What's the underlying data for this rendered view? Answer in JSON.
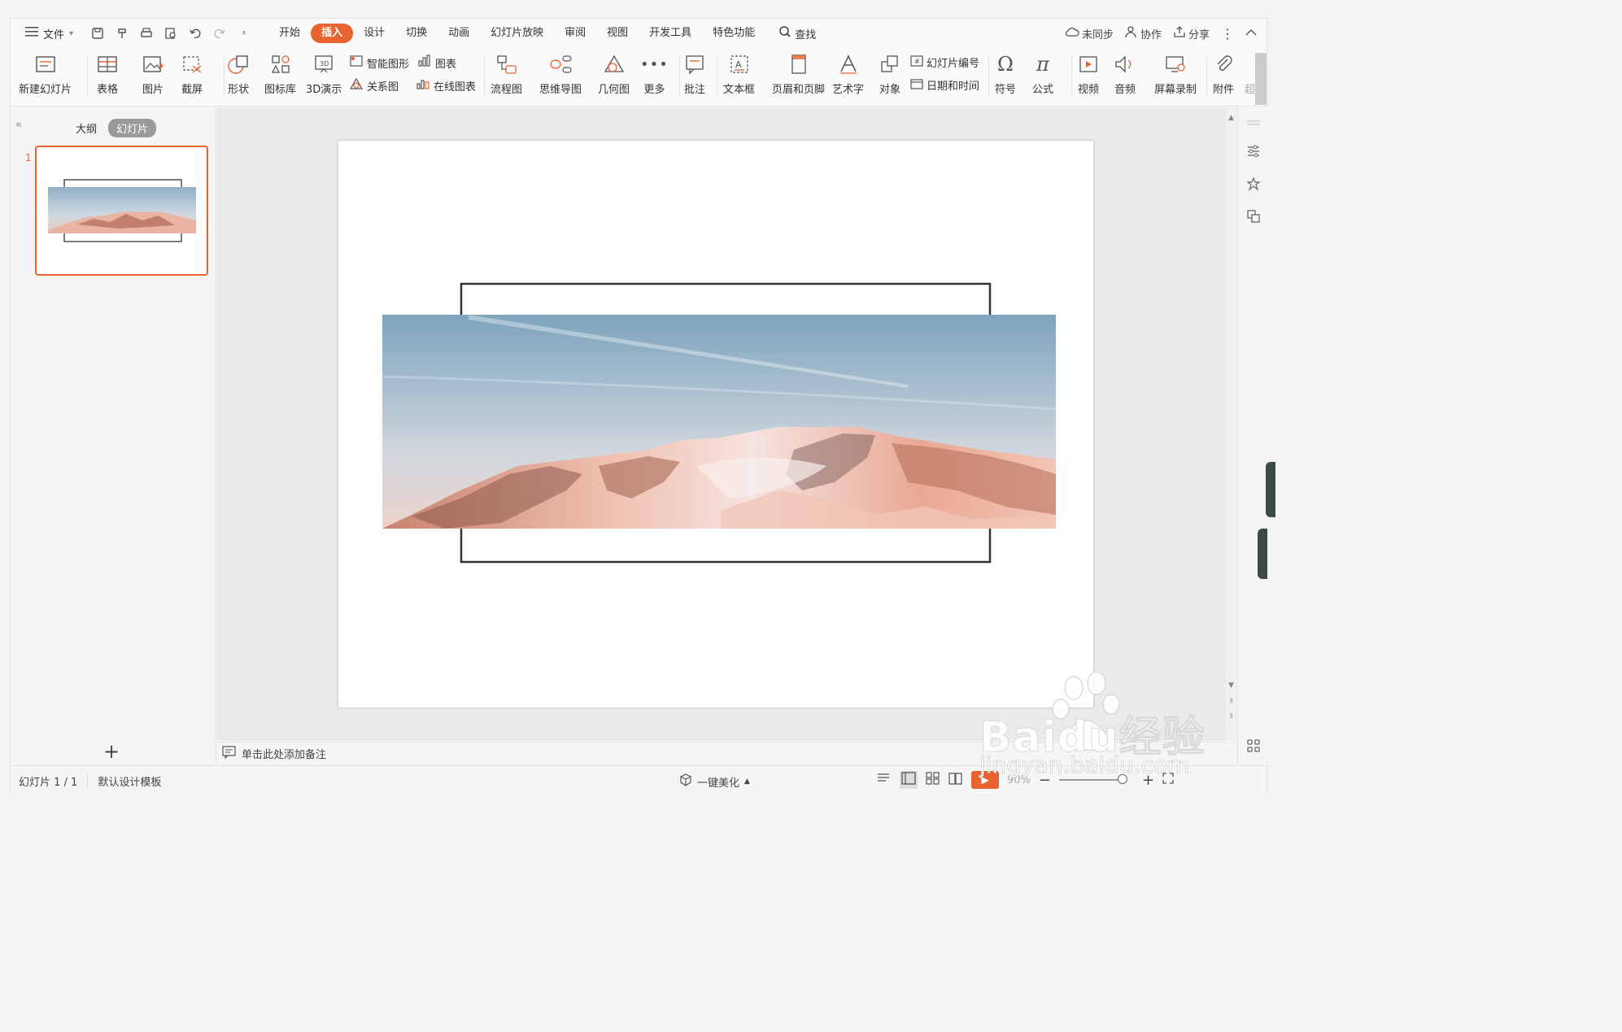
{
  "menubar": {
    "file_label": "文件",
    "tabs": [
      {
        "label": "开始"
      },
      {
        "label": "插入",
        "active": true
      },
      {
        "label": "设计"
      },
      {
        "label": "切换"
      },
      {
        "label": "动画"
      },
      {
        "label": "幻灯片放映"
      },
      {
        "label": "审阅"
      },
      {
        "label": "视图"
      },
      {
        "label": "开发工具"
      },
      {
        "label": "特色功能"
      }
    ],
    "search_label": "查找",
    "sync_label": "未同步",
    "collab_label": "协作",
    "share_label": "分享"
  },
  "ribbon": {
    "new_slide": "新建幻灯片",
    "table": "表格",
    "picture": "图片",
    "screenshot": "截屏",
    "shape": "形状",
    "icon_lib": "图标库",
    "demo3d": "3D演示",
    "smart_graphic": "智能图形",
    "chart": "图表",
    "relation": "关系图",
    "online_chart": "在线图表",
    "flowchart": "流程图",
    "mindmap": "思维导图",
    "geometry": "几何图",
    "more": "更多",
    "comment": "批注",
    "textbox": "文本框",
    "header_footer": "页眉和页脚",
    "wordart": "艺术字",
    "object": "对象",
    "slide_number": "幻灯片编号",
    "datetime": "日期和时间",
    "symbol": "符号",
    "formula": "公式",
    "video": "视频",
    "audio": "音频",
    "screen_record": "屏幕录制",
    "attachment": "附件",
    "more_cut": "超"
  },
  "leftpanel": {
    "outline_tab": "大纲",
    "slides_tab": "幻灯片",
    "thumb_number": "1"
  },
  "notes": {
    "placeholder": "单击此处添加备注"
  },
  "statusbar": {
    "slide_info": "幻灯片 1 / 1",
    "template": "默认设计模板",
    "beautify": "一键美化",
    "zoom": "90%"
  },
  "watermark": {
    "brand": "Baidu经验",
    "url": "jingyan.baidu.com"
  },
  "colors": {
    "accent": "#e8632f",
    "frame": "#333333"
  }
}
